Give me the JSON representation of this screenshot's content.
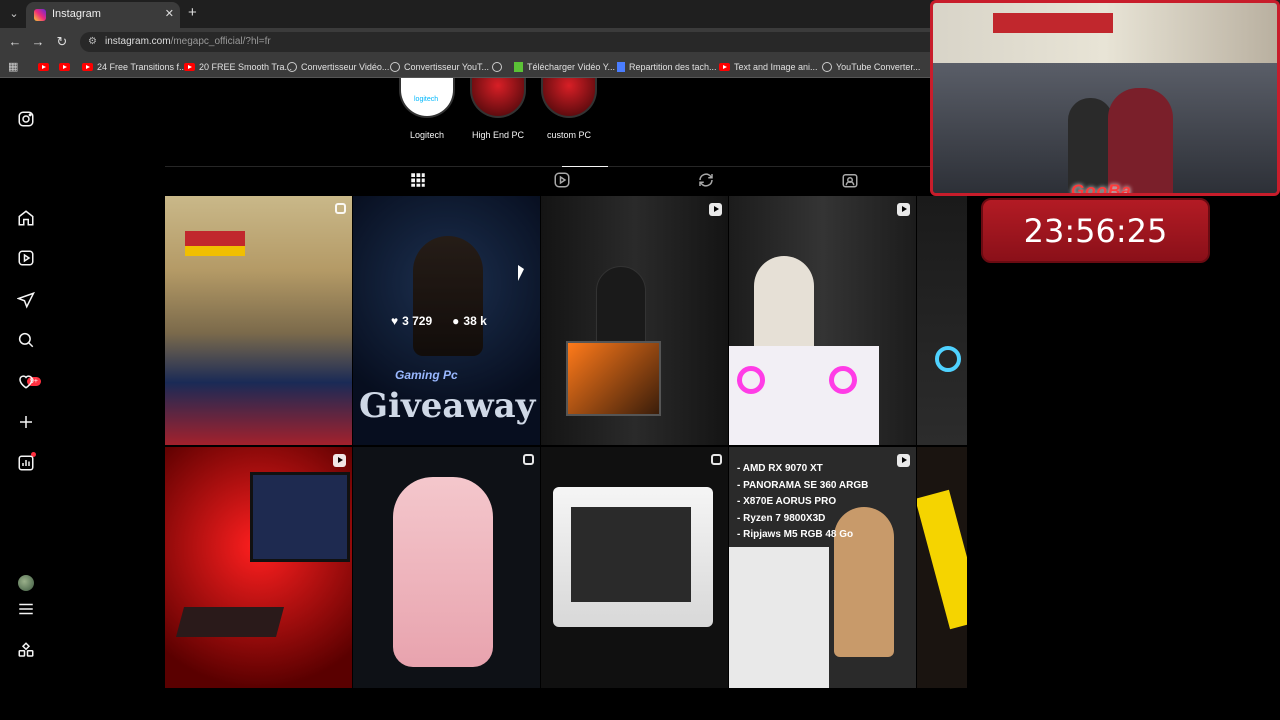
{
  "browser": {
    "tab_title": "Instagram",
    "tab_close": "✕",
    "new_tab": "+",
    "url_main": "instagram.com",
    "url_rest": "/megapc_official/?hl=fr",
    "bookmarks": [
      {
        "label": "",
        "icon": "youtube-icon"
      },
      {
        "label": "",
        "icon": "youtube-icon"
      },
      {
        "label": "24 Free Transitions f...",
        "icon": "youtube-icon"
      },
      {
        "label": "20 FREE Smooth Tra...",
        "icon": "youtube-icon"
      },
      {
        "label": "Convertisseur Vidéo...",
        "icon": "globe-icon"
      },
      {
        "label": "Convertisseur YouT...",
        "icon": "globe-icon"
      },
      {
        "label": "",
        "icon": "globe-icon"
      },
      {
        "label": "Télécharger Vidéo Y...",
        "icon": "download-icon"
      },
      {
        "label": "Repartition des tach...",
        "icon": "doc-icon"
      },
      {
        "label": "Text and Image ani...",
        "icon": "youtube-icon"
      },
      {
        "label": "YouTube Converter...",
        "icon": "globe-icon"
      }
    ]
  },
  "highlights": [
    {
      "label": "Logitech",
      "logo_text": "logitech"
    },
    {
      "label": "High End PC"
    },
    {
      "label": "custom PC"
    }
  ],
  "profile_tabs": [
    "grid-icon",
    "reels-icon",
    "reposts-icon",
    "tagged-icon"
  ],
  "hovered_post": {
    "likes": "3 729",
    "comments": "38 k"
  },
  "posts": [
    {
      "id": "p1",
      "text": ""
    },
    {
      "id": "p2",
      "text": "Giveaway",
      "subtext": "Gaming Pc"
    },
    {
      "id": "p3",
      "text": ""
    },
    {
      "id": "p4",
      "text": ""
    },
    {
      "id": "p5",
      "text": ""
    },
    {
      "id": "p6",
      "text": ""
    },
    {
      "id": "p7",
      "text": ""
    },
    {
      "id": "p8",
      "lines": [
        "- AMD RX 9070 XT",
        "- PANORAMA SE 360 ARGB",
        "- X870E AORUS PRO",
        "- Ryzen 7 9800X3D",
        "- Ripjaws M5 RGB 48 Go"
      ]
    }
  ],
  "stream": {
    "cam_tag": "GooBa",
    "timer": "23:56:25"
  },
  "colors": {
    "bg": "#000000",
    "badge": "#ff3040",
    "timer": "#b31b24"
  }
}
